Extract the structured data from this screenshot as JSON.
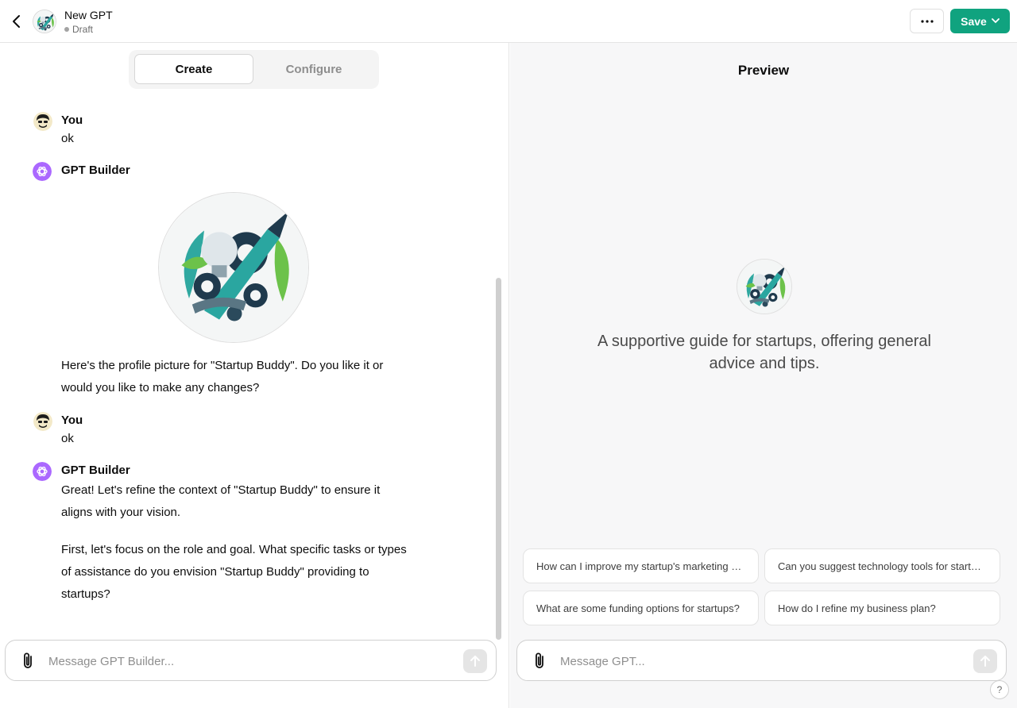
{
  "header": {
    "title": "New GPT",
    "status": "Draft",
    "save_label": "Save",
    "more_label": "···"
  },
  "tabs": [
    {
      "label": "Create",
      "active": true
    },
    {
      "label": "Configure",
      "active": false
    }
  ],
  "messages": [
    {
      "author": "You",
      "text": "ok"
    },
    {
      "author": "GPT Builder",
      "text": "Here's the profile picture for \"Startup Buddy\". Do you like it or would you like to make any changes?",
      "has_image": true
    },
    {
      "author": "You",
      "text": "ok"
    },
    {
      "author": "GPT Builder",
      "text": "Great! Let's refine the context of \"Startup Buddy\" to ensure it aligns with your vision.",
      "text2": "First, let's focus on the role and goal. What specific tasks or types of assistance do you envision \"Startup Buddy\" providing to startups?"
    }
  ],
  "builder_composer": {
    "placeholder": "Message GPT Builder..."
  },
  "preview": {
    "title": "Preview",
    "description": "A supportive guide for startups, offering general advice and tips.",
    "suggestions": [
      "How can I improve my startup's marketing strategy?",
      "Can you suggest technology tools for startups?",
      "What are some funding options for startups?",
      "How do I refine my business plan?"
    ],
    "composer_placeholder": "Message GPT...",
    "help_label": "?"
  },
  "colors": {
    "accent": "#10a37f",
    "builder_avatar": "#ab68ff"
  }
}
